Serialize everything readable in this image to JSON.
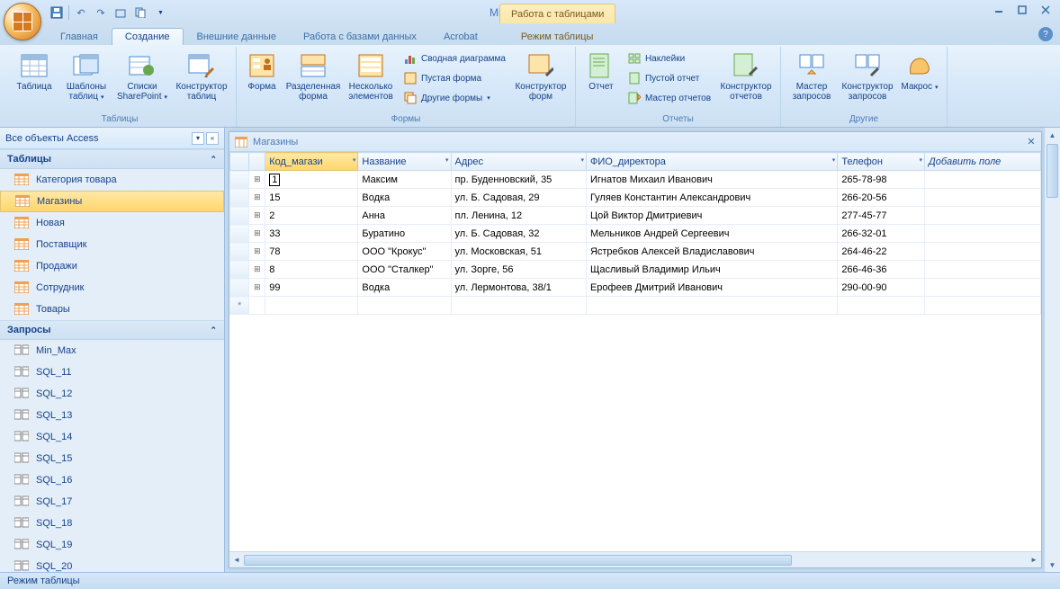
{
  "app_title": "Microsoft Access",
  "context_tab_group": "Работа с таблицами",
  "ribbon_tabs": [
    "Главная",
    "Создание",
    "Внешние данные",
    "Работа с базами данных",
    "Acrobat",
    "Режим таблицы"
  ],
  "active_tab_index": 1,
  "ribbon": {
    "groups": {
      "tables": {
        "label": "Таблицы",
        "buttons": {
          "table": "Таблица",
          "templates": "Шаблоны таблиц",
          "sharepoint": "Списки SharePoint",
          "designer": "Конструктор таблиц"
        }
      },
      "forms": {
        "label": "Формы",
        "buttons": {
          "form": "Форма",
          "split": "Разделенная форма",
          "multi": "Несколько элементов",
          "pivot": "Сводная диаграмма",
          "blank": "Пустая форма",
          "other": "Другие формы",
          "designer": "Конструктор форм"
        }
      },
      "reports": {
        "label": "Отчеты",
        "buttons": {
          "report": "Отчет",
          "labels": "Наклейки",
          "blank": "Пустой отчет",
          "wizard": "Мастер отчетов",
          "designer": "Конструктор отчетов"
        }
      },
      "other": {
        "label": "Другие",
        "buttons": {
          "qwizard": "Мастер запросов",
          "qdesigner": "Конструктор запросов",
          "macro": "Макрос"
        }
      }
    }
  },
  "nav": {
    "header": "Все объекты Access",
    "groups": {
      "tables": {
        "label": "Таблицы",
        "items": [
          "Категория товара",
          "Магазины",
          "Новая",
          "Поставщик",
          "Продажи",
          "Сотрудник",
          "Товары"
        ],
        "selected_index": 1
      },
      "queries": {
        "label": "Запросы",
        "items": [
          "Min_Max",
          "SQL_11",
          "SQL_12",
          "SQL_13",
          "SQL_14",
          "SQL_15",
          "SQL_16",
          "SQL_17",
          "SQL_18",
          "SQL_19",
          "SQL_20"
        ]
      }
    }
  },
  "document": {
    "title": "Магазины",
    "columns": [
      "Код_магази",
      "Название",
      "Адрес",
      "ФИО_директора",
      "Телефон"
    ],
    "add_field": "Добавить поле",
    "active_cell_value": "1",
    "rows": [
      {
        "code": "1",
        "name": "Максим",
        "addr": "пр. Буденновский, 35",
        "dir": "Игнатов Михаил Иванович",
        "tel": "265-78-98"
      },
      {
        "code": "15",
        "name": "Водка",
        "addr": "ул. Б. Садовая, 29",
        "dir": "Гуляев Константин Александрович",
        "tel": "266-20-56"
      },
      {
        "code": "2",
        "name": "Анна",
        "addr": "пл. Ленина, 12",
        "dir": "Цой Виктор Дмитриевич",
        "tel": "277-45-77"
      },
      {
        "code": "33",
        "name": "Буратино",
        "addr": "ул. Б. Садовая, 32",
        "dir": "Мельников Андрей Сергеевич",
        "tel": "266-32-01"
      },
      {
        "code": "78",
        "name": "ООО \"Крокус\"",
        "addr": "ул. Московская, 51",
        "dir": "Ястребков Алексей Владиславович",
        "tel": "264-46-22"
      },
      {
        "code": "8",
        "name": "ООО \"Сталкер\"",
        "addr": "ул. Зорге, 56",
        "dir": "Щасливый Владимир Ильич",
        "tel": "266-46-36"
      },
      {
        "code": "99",
        "name": "Водка",
        "addr": "ул. Лермонтова, 38/1",
        "dir": "Ерофеев Дмитрий Иванович",
        "tel": "290-00-90"
      }
    ]
  },
  "status_bar": "Режим таблицы"
}
